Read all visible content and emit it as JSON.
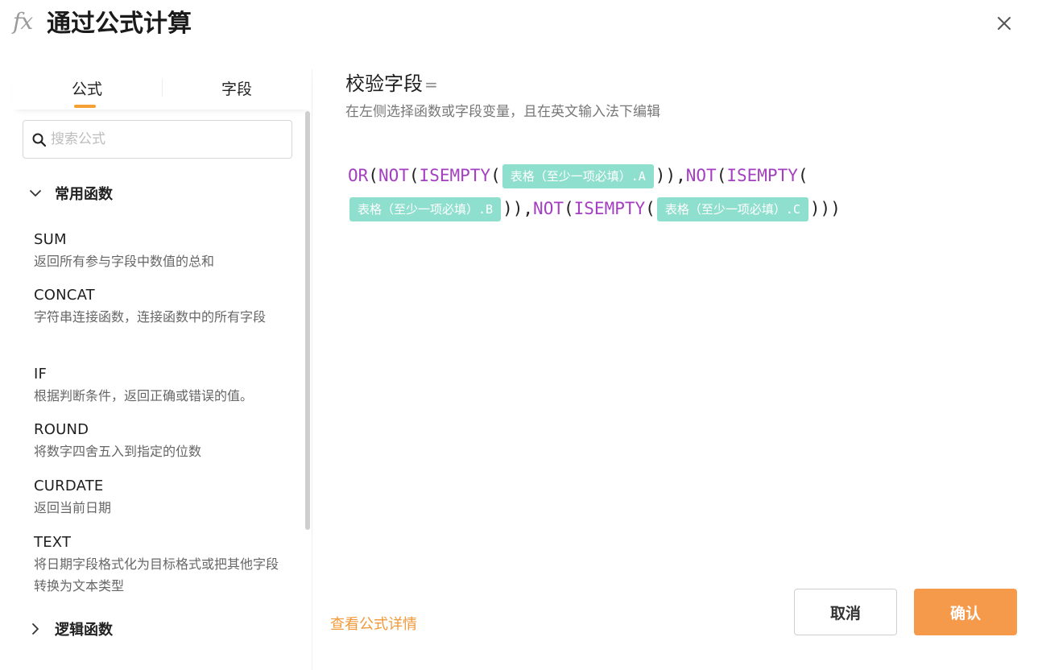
{
  "header": {
    "fx_icon": "fx",
    "title": "通过公式计算",
    "close_icon": "close-icon"
  },
  "left_panel": {
    "tabs": [
      {
        "label": "公式",
        "active": true
      },
      {
        "label": "字段",
        "active": false
      }
    ],
    "search": {
      "placeholder": "搜索公式",
      "value": ""
    },
    "groups": [
      {
        "title": "常用函数",
        "expanded": true,
        "items": [
          {
            "name": "SUM",
            "desc": "返回所有参与字段中数值的总和"
          },
          {
            "name": "CONCAT",
            "desc": "字符串连接函数，连接函数中的所有字段"
          },
          {
            "name": "IF",
            "desc": "根据判断条件，返回正确或错误的值。"
          },
          {
            "name": "ROUND",
            "desc": "将数字四舍五入到指定的位数"
          },
          {
            "name": "CURDATE",
            "desc": "返回当前日期"
          },
          {
            "name": "TEXT",
            "desc": "将日期字段格式化为目标格式或把其他字段转换为文本类型"
          }
        ]
      },
      {
        "title": "逻辑函数",
        "expanded": false
      }
    ]
  },
  "editor": {
    "field_title": "校验字段",
    "equals": "=",
    "hint": "在左侧选择函数或字段变量，且在英文输入法下编辑",
    "tokens": {
      "or": "OR",
      "not": "NOT",
      "isempty": "ISEMPTY",
      "lparen": "(",
      "rparen": ")",
      "comma": ",",
      "field_label": "表格（至少一项必填）",
      "suffix_a": ".A",
      "suffix_b": ".B",
      "suffix_c": ".C"
    }
  },
  "footer": {
    "details_link": "查看公式详情",
    "cancel_label": "取消",
    "confirm_label": "确认"
  },
  "colors": {
    "accent": "#f5994a",
    "tab_underline": "#f5a033",
    "function_text": "#a33fc0",
    "field_chip": "#8fdfce",
    "link": "#f2993a"
  }
}
